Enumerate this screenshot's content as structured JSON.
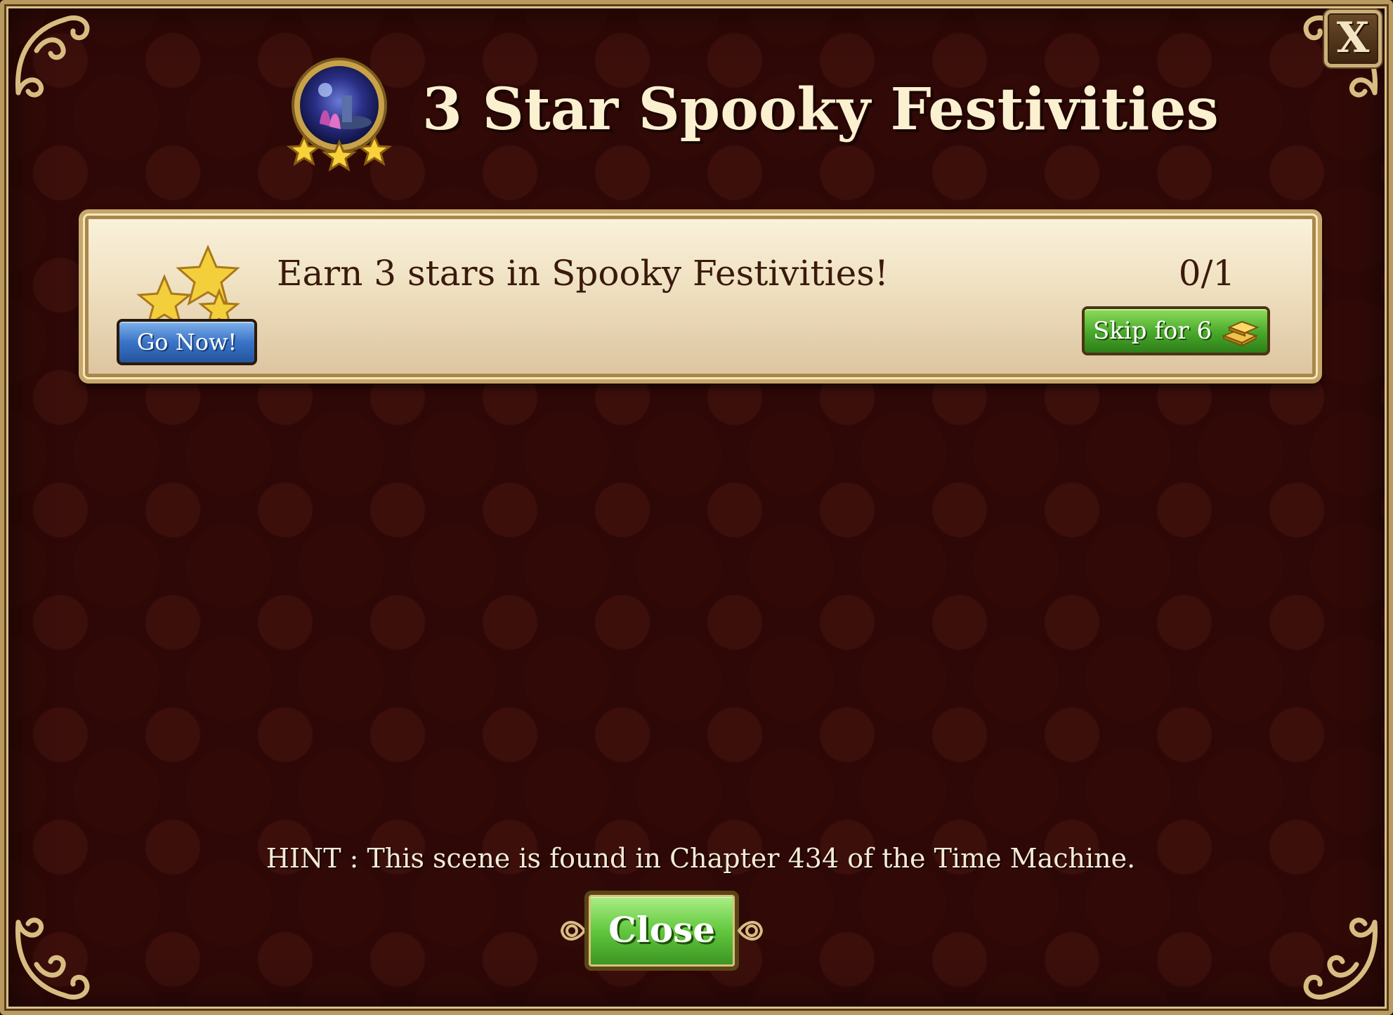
{
  "dialog": {
    "title": "3 Star Spooky Festivities",
    "close_x_label": "X"
  },
  "objective": {
    "text": "Earn 3 stars in Spooky Festivities!",
    "progress": "0/1",
    "go_button": "Go Now!",
    "skip_button": "Skip for 6",
    "skip_icon": "gold-bars-icon"
  },
  "hint": "HINT : This scene is found in Chapter 434 of the Time Machine.",
  "close_button": "Close",
  "colors": {
    "background": "#2e0806",
    "frame_gold": "#c7a669",
    "title_text": "#fbf0cf",
    "go_button": "#3a74c8",
    "skip_button": "#47a82a",
    "close_button": "#62c83e"
  }
}
